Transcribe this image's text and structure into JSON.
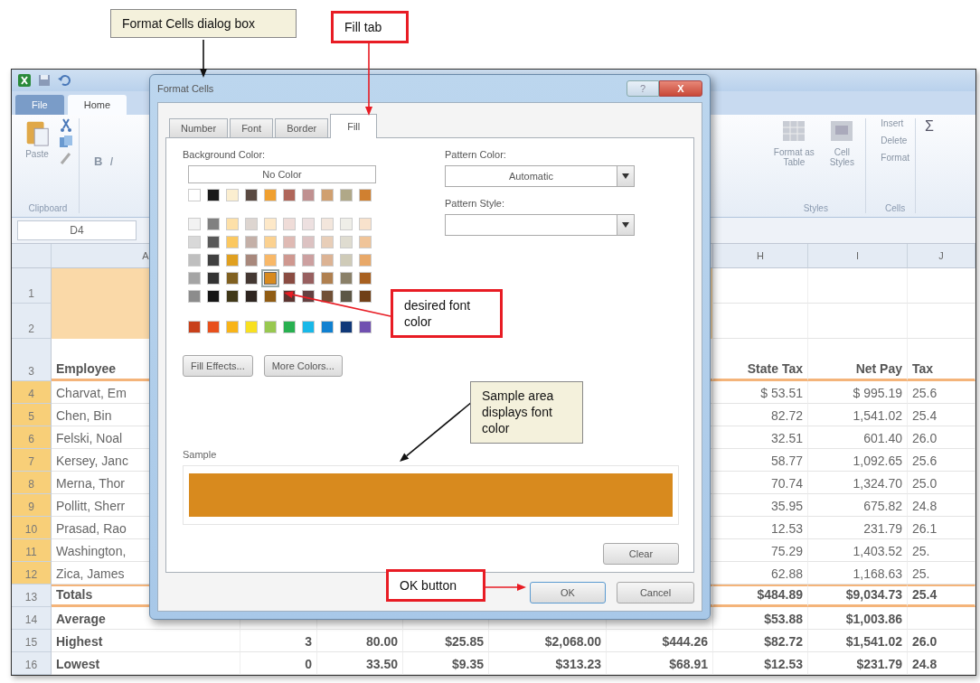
{
  "callouts": [
    {
      "text": "Format Cells dialog box",
      "kind": "note"
    },
    {
      "text": "Fill tab",
      "kind": "highlight"
    },
    {
      "text": "desired font color",
      "kind": "highlight"
    },
    {
      "text": "Sample area displays font color",
      "kind": "note"
    },
    {
      "text": "OK button",
      "kind": "highlight"
    }
  ],
  "ribbon_tabs": [
    {
      "label": "File",
      "selected": false
    },
    {
      "label": "Home",
      "selected": true
    }
  ],
  "ribbon": {
    "paste": "Paste",
    "clipboard": "Clipboard",
    "bold": "B",
    "italic": "I",
    "format_table": "Format as Table",
    "cell_styles": "Cell Styles",
    "styles_group": "Styles",
    "cell_commands": [
      "Insert",
      "Delete",
      "Format"
    ],
    "cells_group": "Cells",
    "sum": "Σ"
  },
  "name_box": "D4",
  "sheet": {
    "column_headers": {
      "A": "A",
      "H": "H",
      "I": "I",
      "J": "J"
    },
    "rows": [
      {
        "number": "1",
        "kind": "title",
        "selected": false,
        "cells": {}
      },
      {
        "number": "2",
        "kind": "title",
        "selected": false,
        "cells": {}
      },
      {
        "number": "3",
        "kind": "header",
        "selected": false,
        "cells": {
          "A": "Employee",
          "H": "State Tax",
          "I": "Net Pay",
          "J": "Tax"
        }
      },
      {
        "number": "4",
        "kind": "data",
        "selected": true,
        "cells": {
          "A": "Charvat, Em",
          "H": "$ 53.51",
          "I": "$ 995.19",
          "J": "25.6"
        }
      },
      {
        "number": "5",
        "kind": "data",
        "selected": true,
        "cells": {
          "A": "Chen, Bin",
          "H": "82.72",
          "I": "1,541.02",
          "J": "25.4"
        }
      },
      {
        "number": "6",
        "kind": "data",
        "selected": true,
        "cells": {
          "A": "Felski, Noal",
          "H": "32.51",
          "I": "601.40",
          "J": "26.0"
        }
      },
      {
        "number": "7",
        "kind": "data",
        "selected": true,
        "cells": {
          "A": "Kersey, Janc",
          "H": "58.77",
          "I": "1,092.65",
          "J": "25.6"
        }
      },
      {
        "number": "8",
        "kind": "data",
        "selected": true,
        "cells": {
          "A": "Merna, Thor",
          "H": "70.74",
          "I": "1,324.70",
          "J": "25.0"
        }
      },
      {
        "number": "9",
        "kind": "data",
        "selected": true,
        "cells": {
          "A": "Pollitt, Sherr",
          "H": "35.95",
          "I": "675.82",
          "J": "24.8"
        }
      },
      {
        "number": "10",
        "kind": "data",
        "selected": true,
        "cells": {
          "A": "Prasad, Rao",
          "H": "12.53",
          "I": "231.79",
          "J": "26.1"
        }
      },
      {
        "number": "11",
        "kind": "data",
        "selected": true,
        "cells": {
          "A": "Washington,",
          "H": "75.29",
          "I": "1,403.52",
          "J": "25."
        }
      },
      {
        "number": "12",
        "kind": "data",
        "selected": true,
        "cells": {
          "A": "Zica, James",
          "H": "62.88",
          "I": "1,168.63",
          "J": "25."
        }
      },
      {
        "number": "13",
        "kind": "total",
        "selected": false,
        "cells": {
          "A": "Totals",
          "H": "$484.89",
          "I": "$9,034.73",
          "J": "25.4"
        }
      },
      {
        "number": "14",
        "kind": "summary",
        "selected": false,
        "cells": {
          "A": "Average",
          "H": "$53.88",
          "I": "$1,003.86"
        }
      },
      {
        "number": "15",
        "kind": "summary",
        "selected": false,
        "cells": {
          "A": "Highest",
          "B": "3",
          "C": "80.00",
          "D": "$25.85",
          "E": "$2,068.00",
          "F": "$444.26",
          "H": "$82.72",
          "I": "$1,541.02",
          "J": "26.0"
        }
      },
      {
        "number": "16",
        "kind": "summary",
        "selected": false,
        "cells": {
          "A": "Lowest",
          "B": "0",
          "C": "33.50",
          "D": "$9.35",
          "E": "$313.23",
          "F": "$68.91",
          "H": "$12.53",
          "I": "$231.79",
          "J": "24.8"
        }
      }
    ]
  },
  "dialog": {
    "title": "Format Cells",
    "help": "?",
    "close": "X",
    "tabs": [
      {
        "label": "Number",
        "selected": false
      },
      {
        "label": "Font",
        "selected": false
      },
      {
        "label": "Border",
        "selected": false
      },
      {
        "label": "Fill",
        "selected": true
      }
    ],
    "background_color_label": "Background Color:",
    "no_color": "No Color",
    "theme_colors": [
      {
        "color": "#ffffff",
        "selected": false
      },
      {
        "color": "#1a1a1a",
        "selected": false
      },
      {
        "color": "#fbeed0",
        "selected": false
      },
      {
        "color": "#5a4a42",
        "selected": false
      },
      {
        "color": "#f0a030",
        "selected": false
      },
      {
        "color": "#b0665a",
        "selected": false
      },
      {
        "color": "#c09090",
        "selected": false
      },
      {
        "color": "#d0a070",
        "selected": false
      },
      {
        "color": "#b0a888",
        "selected": false
      },
      {
        "color": "#d08030",
        "selected": false
      }
    ],
    "tint_rows": [
      [
        {
          "color": "#f2f2f2",
          "selected": false
        },
        {
          "color": "#808080",
          "selected": false
        },
        {
          "color": "#fde0a8",
          "selected": false
        },
        {
          "color": "#ddd5d0",
          "selected": false
        },
        {
          "color": "#fde8c8",
          "selected": false
        },
        {
          "color": "#efdcd8",
          "selected": false
        },
        {
          "color": "#ede0e0",
          "selected": false
        },
        {
          "color": "#f3e6dc",
          "selected": false
        },
        {
          "color": "#efeee8",
          "selected": false
        },
        {
          "color": "#f8e2cc",
          "selected": false
        }
      ],
      [
        {
          "color": "#d8d8d8",
          "selected": false
        },
        {
          "color": "#595959",
          "selected": false
        },
        {
          "color": "#fbc860",
          "selected": false
        },
        {
          "color": "#c4b0a8",
          "selected": false
        },
        {
          "color": "#fbd190",
          "selected": false
        },
        {
          "color": "#dfbab4",
          "selected": false
        },
        {
          "color": "#dcc2c2",
          "selected": false
        },
        {
          "color": "#e8ceb8",
          "selected": false
        },
        {
          "color": "#dfdcd0",
          "selected": false
        },
        {
          "color": "#f0c498",
          "selected": false
        }
      ],
      [
        {
          "color": "#bfbfbf",
          "selected": false
        },
        {
          "color": "#404040",
          "selected": false
        },
        {
          "color": "#e0a020",
          "selected": false
        },
        {
          "color": "#a8887c",
          "selected": false
        },
        {
          "color": "#f8b868",
          "selected": false
        },
        {
          "color": "#cf9890",
          "selected": false
        },
        {
          "color": "#cca0a0",
          "selected": false
        },
        {
          "color": "#dcb394",
          "selected": false
        },
        {
          "color": "#cfcbb8",
          "selected": false
        },
        {
          "color": "#e8a868",
          "selected": false
        }
      ],
      [
        {
          "color": "#a5a5a5",
          "selected": false
        },
        {
          "color": "#333333",
          "selected": false
        },
        {
          "color": "#806020",
          "selected": false
        },
        {
          "color": "#443832",
          "selected": false
        },
        {
          "color": "#d88a1e",
          "selected": true
        },
        {
          "color": "#8a4c42",
          "selected": false
        },
        {
          "color": "#986060",
          "selected": false
        },
        {
          "color": "#b08050",
          "selected": false
        },
        {
          "color": "#8a8068",
          "selected": false
        },
        {
          "color": "#a86020",
          "selected": false
        }
      ],
      [
        {
          "color": "#8c8c8c",
          "selected": false
        },
        {
          "color": "#151515",
          "selected": false
        },
        {
          "color": "#403818",
          "selected": false
        },
        {
          "color": "#2e2520",
          "selected": false
        },
        {
          "color": "#905c14",
          "selected": false
        },
        {
          "color": "#5c3430",
          "selected": false
        },
        {
          "color": "#644040",
          "selected": false
        },
        {
          "color": "#705036",
          "selected": false
        },
        {
          "color": "#5c5645",
          "selected": false
        },
        {
          "color": "#704018",
          "selected": false
        }
      ]
    ],
    "standard_colors": [
      {
        "color": "#c8401a",
        "selected": false
      },
      {
        "color": "#e8501c",
        "selected": false
      },
      {
        "color": "#f8b418",
        "selected": false
      },
      {
        "color": "#f8e020",
        "selected": false
      },
      {
        "color": "#98c850",
        "selected": false
      },
      {
        "color": "#28b050",
        "selected": false
      },
      {
        "color": "#18b8e8",
        "selected": false
      },
      {
        "color": "#1080d0",
        "selected": false
      },
      {
        "color": "#103878",
        "selected": false
      },
      {
        "color": "#7050b0",
        "selected": false
      }
    ],
    "fill_effects": "Fill Effects...",
    "more_colors": "More Colors...",
    "pattern_color_label": "Pattern Color:",
    "pattern_color_value": "Automatic",
    "pattern_style_label": "Pattern Style:",
    "sample_label": "Sample",
    "clear": "Clear",
    "ok": "OK",
    "cancel": "Cancel"
  }
}
